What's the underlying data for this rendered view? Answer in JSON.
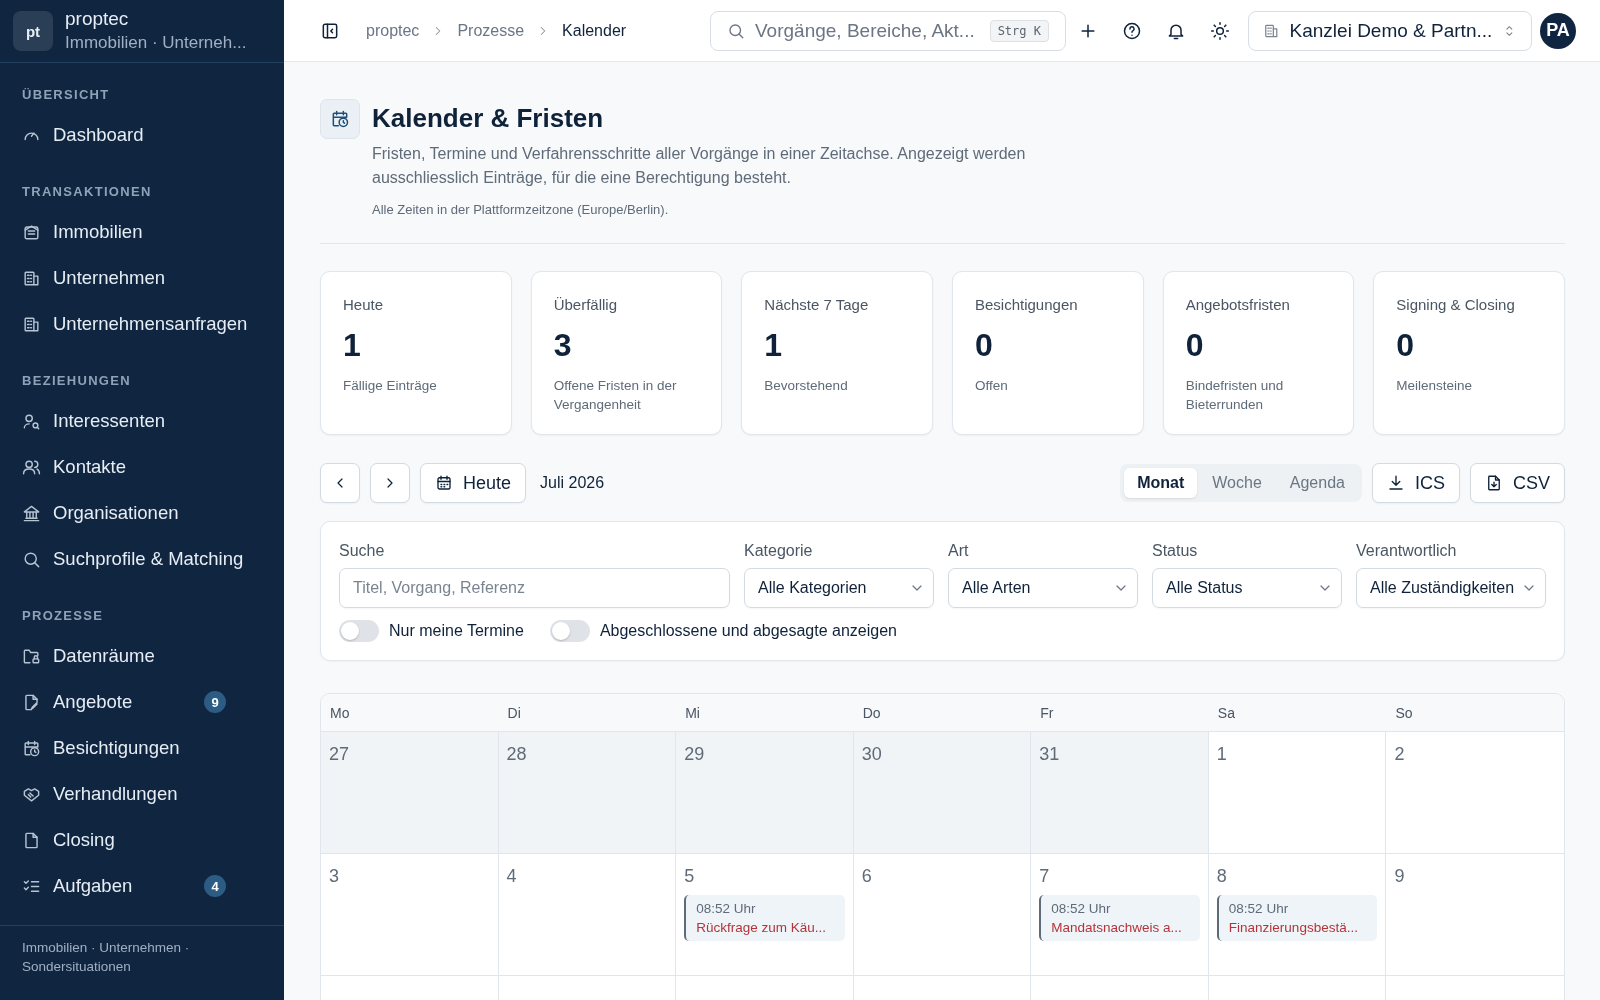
{
  "sidebar": {
    "brand": {
      "logo": "pt",
      "name": "proptec",
      "subtitle": "Immobilien · Unterneh..."
    },
    "sections": [
      {
        "title": "ÜBERSICHT",
        "items": [
          {
            "label": "Dashboard"
          }
        ]
      },
      {
        "title": "TRANSAKTIONEN",
        "items": [
          {
            "label": "Immobilien"
          },
          {
            "label": "Unternehmen"
          },
          {
            "label": "Unternehmensanfragen"
          }
        ]
      },
      {
        "title": "BEZIEHUNGEN",
        "items": [
          {
            "label": "Interessenten"
          },
          {
            "label": "Kontakte"
          },
          {
            "label": "Organisationen"
          },
          {
            "label": "Suchprofile & Matching"
          }
        ]
      },
      {
        "title": "PROZESSE",
        "items": [
          {
            "label": "Datenräume"
          },
          {
            "label": "Angebote",
            "badge": "9"
          },
          {
            "label": "Besichtigungen"
          },
          {
            "label": "Verhandlungen"
          },
          {
            "label": "Closing"
          },
          {
            "label": "Aufgaben",
            "badge": "4"
          }
        ]
      }
    ],
    "footer": "Immobilien · Unternehmen · Sondersituationen"
  },
  "topbar": {
    "breadcrumb": [
      {
        "label": "proptec",
        "current": false
      },
      {
        "label": "Prozesse",
        "current": false
      },
      {
        "label": "Kalender",
        "current": true
      }
    ],
    "search": {
      "placeholder": "Vorgänge, Bereiche, Akt...",
      "shortcut": "Strg K"
    },
    "organization": "Kanzlei Demo & Partn...",
    "avatar": "PA"
  },
  "header": {
    "title": "Kalender & Fristen",
    "description": "Fristen, Termine und Verfahrensschritte aller Vorgänge in einer Zeitachse. Angezeigt werden ausschliesslich Einträge, für die eine Berechtigung besteht.",
    "note": "Alle Zeiten in der Plattformzeitzone (Europe/Berlin)."
  },
  "stats": [
    {
      "label": "Heute",
      "value": "1",
      "caption": "Fällige Einträge"
    },
    {
      "label": "Überfällig",
      "value": "3",
      "caption": "Offene Fristen in der Vergangenheit"
    },
    {
      "label": "Nächste 7 Tage",
      "value": "1",
      "caption": "Bevorstehend"
    },
    {
      "label": "Besichtigungen",
      "value": "0",
      "caption": "Offen"
    },
    {
      "label": "Angebotsfristen",
      "value": "0",
      "caption": "Bindefristen und Bieterrunden"
    },
    {
      "label": "Signing & Closing",
      "value": "0",
      "caption": "Meilensteine"
    }
  ],
  "toolbar": {
    "today": "Heute",
    "month_label": "Juli 2026",
    "views": [
      {
        "label": "Monat",
        "selected": true
      },
      {
        "label": "Woche",
        "selected": false
      },
      {
        "label": "Agenda",
        "selected": false
      }
    ],
    "exports": [
      {
        "label": "ICS"
      },
      {
        "label": "CSV"
      }
    ]
  },
  "filters": {
    "search": {
      "label": "Suche",
      "placeholder": "Titel, Vorgang, Referenz"
    },
    "selects": [
      {
        "label": "Kategorie",
        "value": "Alle Kategorien"
      },
      {
        "label": "Art",
        "value": "Alle Arten"
      },
      {
        "label": "Status",
        "value": "Alle Status"
      },
      {
        "label": "Verantwortlich",
        "value": "Alle Zuständigkeiten"
      }
    ],
    "toggles": [
      {
        "label": "Nur meine Termine",
        "on": false
      },
      {
        "label": "Abgeschlossene und abgesagte anzeigen",
        "on": false
      }
    ]
  },
  "calendar": {
    "weekdays": [
      "Mo",
      "Di",
      "Mi",
      "Do",
      "Fr",
      "Sa",
      "So"
    ],
    "weeks": [
      [
        {
          "day": "27",
          "outside": true
        },
        {
          "day": "28",
          "outside": true
        },
        {
          "day": "29",
          "outside": true
        },
        {
          "day": "30",
          "outside": true
        },
        {
          "day": "31",
          "outside": true
        },
        {
          "day": "1",
          "outside": false
        },
        {
          "day": "2",
          "outside": false
        }
      ],
      [
        {
          "day": "3",
          "outside": false
        },
        {
          "day": "4",
          "outside": false
        },
        {
          "day": "5",
          "outside": false,
          "events": [
            {
              "time": "08:52 Uhr",
              "title": "Rückfrage zum Käu...",
              "overdue": true
            }
          ]
        },
        {
          "day": "6",
          "outside": false
        },
        {
          "day": "7",
          "outside": false,
          "events": [
            {
              "time": "08:52 Uhr",
              "title": "Mandatsnachweis a...",
              "overdue": true
            }
          ]
        },
        {
          "day": "8",
          "outside": false,
          "events": [
            {
              "time": "08:52 Uhr",
              "title": "Finanzierungsbestä...",
              "overdue": true
            }
          ]
        },
        {
          "day": "9",
          "outside": false
        }
      ]
    ]
  }
}
